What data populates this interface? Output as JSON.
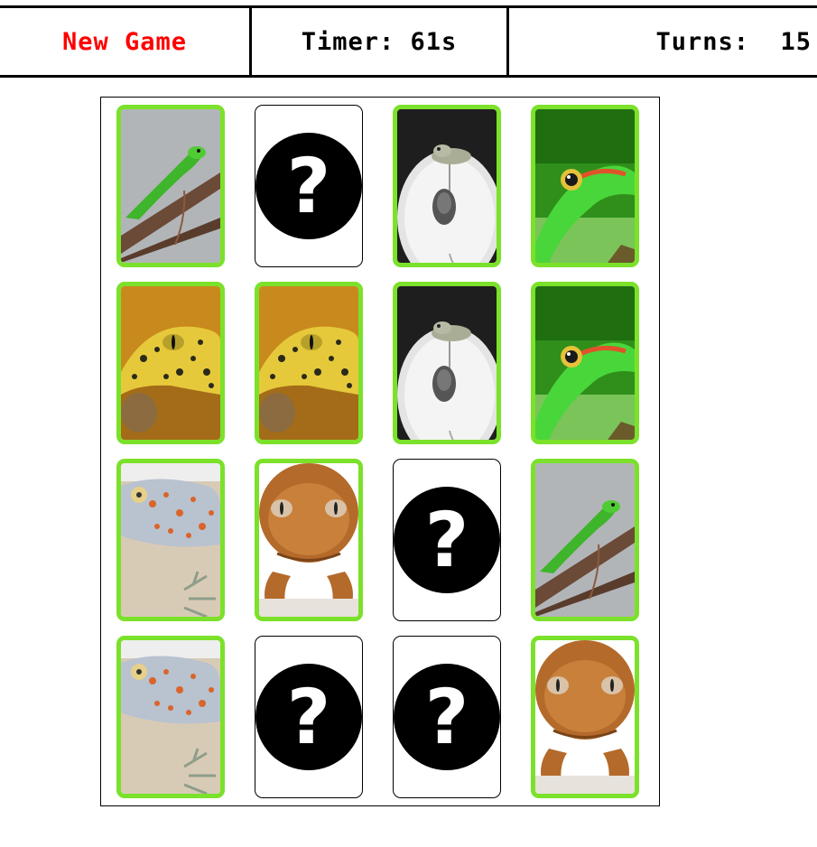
{
  "header": {
    "new_game_label": "New Game",
    "timer_text": "Timer: 61s",
    "turns_text": "Turns:  15"
  },
  "colors": {
    "new_game": "#ff0000",
    "matched_border": "#7be12a",
    "card_back": "#000000"
  },
  "board": {
    "rows": [
      [
        {
          "state": "revealed",
          "image": "green-gecko-on-branch-image"
        },
        {
          "state": "hidden",
          "glyph": "?"
        },
        {
          "state": "revealed",
          "image": "frog-on-computer-mouse-image"
        },
        {
          "state": "revealed",
          "image": "green-gecko-closeup-image"
        }
      ],
      [
        {
          "state": "revealed",
          "image": "leopard-gecko-image"
        },
        {
          "state": "revealed",
          "image": "leopard-gecko-image"
        },
        {
          "state": "revealed",
          "image": "frog-on-computer-mouse-image"
        },
        {
          "state": "revealed",
          "image": "green-gecko-closeup-image"
        }
      ],
      [
        {
          "state": "revealed",
          "image": "tokay-gecko-image"
        },
        {
          "state": "revealed",
          "image": "brown-gecko-image"
        },
        {
          "state": "hidden",
          "glyph": "?"
        },
        {
          "state": "revealed",
          "image": "green-gecko-on-branch-image"
        }
      ],
      [
        {
          "state": "revealed",
          "image": "tokay-gecko-image"
        },
        {
          "state": "hidden",
          "glyph": "?"
        },
        {
          "state": "hidden",
          "glyph": "?"
        },
        {
          "state": "revealed",
          "image": "brown-gecko-image"
        }
      ]
    ]
  }
}
